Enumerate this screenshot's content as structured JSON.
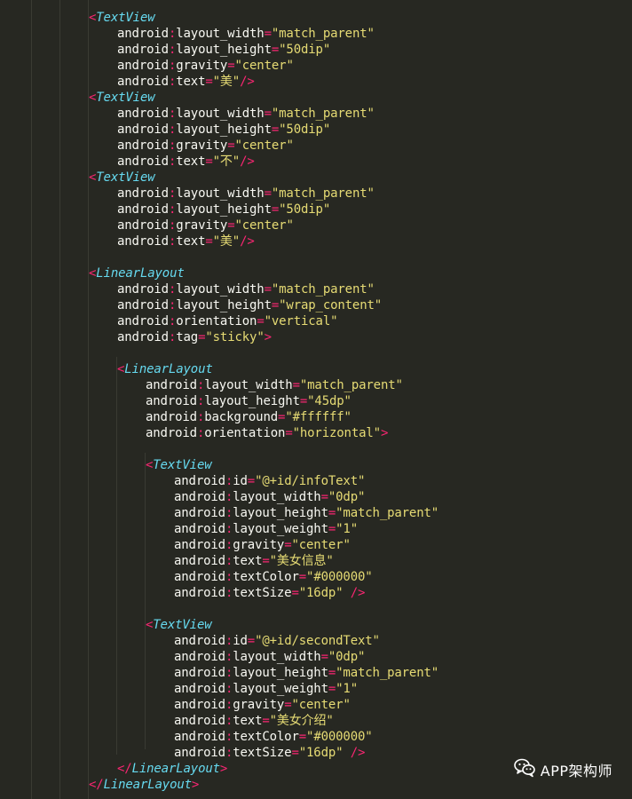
{
  "editor": {
    "theme_colors": {
      "background": "#272822",
      "tag": "#66d9ef",
      "punctuation": "#f92672",
      "attribute": "#f8f8f2",
      "string": "#e6db74"
    },
    "lines": [
      {
        "indent": 1,
        "type": "open",
        "tag": "TextView"
      },
      {
        "indent": 2,
        "type": "attr",
        "ns": "android",
        "name": "layout_width",
        "value": "match_parent"
      },
      {
        "indent": 2,
        "type": "attr",
        "ns": "android",
        "name": "layout_height",
        "value": "50dip"
      },
      {
        "indent": 2,
        "type": "attr",
        "ns": "android",
        "name": "gravity",
        "value": "center"
      },
      {
        "indent": 2,
        "type": "attr",
        "ns": "android",
        "name": "text",
        "value": "美",
        "suffix": "/>"
      },
      {
        "indent": 1,
        "type": "open",
        "tag": "TextView"
      },
      {
        "indent": 2,
        "type": "attr",
        "ns": "android",
        "name": "layout_width",
        "value": "match_parent"
      },
      {
        "indent": 2,
        "type": "attr",
        "ns": "android",
        "name": "layout_height",
        "value": "50dip"
      },
      {
        "indent": 2,
        "type": "attr",
        "ns": "android",
        "name": "gravity",
        "value": "center"
      },
      {
        "indent": 2,
        "type": "attr",
        "ns": "android",
        "name": "text",
        "value": "不",
        "suffix": "/>"
      },
      {
        "indent": 1,
        "type": "open",
        "tag": "TextView"
      },
      {
        "indent": 2,
        "type": "attr",
        "ns": "android",
        "name": "layout_width",
        "value": "match_parent"
      },
      {
        "indent": 2,
        "type": "attr",
        "ns": "android",
        "name": "layout_height",
        "value": "50dip"
      },
      {
        "indent": 2,
        "type": "attr",
        "ns": "android",
        "name": "gravity",
        "value": "center"
      },
      {
        "indent": 2,
        "type": "attr",
        "ns": "android",
        "name": "text",
        "value": "美",
        "suffix": "/>"
      },
      {
        "type": "blank"
      },
      {
        "indent": 1,
        "type": "open",
        "tag": "LinearLayout"
      },
      {
        "indent": 2,
        "type": "attr",
        "ns": "android",
        "name": "layout_width",
        "value": "match_parent"
      },
      {
        "indent": 2,
        "type": "attr",
        "ns": "android",
        "name": "layout_height",
        "value": "wrap_content"
      },
      {
        "indent": 2,
        "type": "attr",
        "ns": "android",
        "name": "orientation",
        "value": "vertical"
      },
      {
        "indent": 2,
        "type": "attr",
        "ns": "android",
        "name": "tag",
        "value": "sticky",
        "suffix": ">"
      },
      {
        "type": "blank"
      },
      {
        "indent": 2,
        "type": "open",
        "tag": "LinearLayout"
      },
      {
        "indent": 3,
        "type": "attr",
        "ns": "android",
        "name": "layout_width",
        "value": "match_parent"
      },
      {
        "indent": 3,
        "type": "attr",
        "ns": "android",
        "name": "layout_height",
        "value": "45dp"
      },
      {
        "indent": 3,
        "type": "attr",
        "ns": "android",
        "name": "background",
        "value": "#ffffff"
      },
      {
        "indent": 3,
        "type": "attr",
        "ns": "android",
        "name": "orientation",
        "value": "horizontal",
        "suffix": ">"
      },
      {
        "type": "blank"
      },
      {
        "indent": 3,
        "type": "open",
        "tag": "TextView"
      },
      {
        "indent": 4,
        "type": "attr",
        "ns": "android",
        "name": "id",
        "value": "@+id/infoText"
      },
      {
        "indent": 4,
        "type": "attr",
        "ns": "android",
        "name": "layout_width",
        "value": "0dp"
      },
      {
        "indent": 4,
        "type": "attr",
        "ns": "android",
        "name": "layout_height",
        "value": "match_parent"
      },
      {
        "indent": 4,
        "type": "attr",
        "ns": "android",
        "name": "layout_weight",
        "value": "1"
      },
      {
        "indent": 4,
        "type": "attr",
        "ns": "android",
        "name": "gravity",
        "value": "center"
      },
      {
        "indent": 4,
        "type": "attr",
        "ns": "android",
        "name": "text",
        "value": "美女信息"
      },
      {
        "indent": 4,
        "type": "attr",
        "ns": "android",
        "name": "textColor",
        "value": "#000000"
      },
      {
        "indent": 4,
        "type": "attr",
        "ns": "android",
        "name": "textSize",
        "value": "16dp",
        "suffix": " />"
      },
      {
        "type": "blank"
      },
      {
        "indent": 3,
        "type": "open",
        "tag": "TextView"
      },
      {
        "indent": 4,
        "type": "attr",
        "ns": "android",
        "name": "id",
        "value": "@+id/secondText"
      },
      {
        "indent": 4,
        "type": "attr",
        "ns": "android",
        "name": "layout_width",
        "value": "0dp"
      },
      {
        "indent": 4,
        "type": "attr",
        "ns": "android",
        "name": "layout_height",
        "value": "match_parent"
      },
      {
        "indent": 4,
        "type": "attr",
        "ns": "android",
        "name": "layout_weight",
        "value": "1"
      },
      {
        "indent": 4,
        "type": "attr",
        "ns": "android",
        "name": "gravity",
        "value": "center"
      },
      {
        "indent": 4,
        "type": "attr",
        "ns": "android",
        "name": "text",
        "value": "美女介绍"
      },
      {
        "indent": 4,
        "type": "attr",
        "ns": "android",
        "name": "textColor",
        "value": "#000000"
      },
      {
        "indent": 4,
        "type": "attr",
        "ns": "android",
        "name": "textSize",
        "value": "16dp",
        "suffix": " />"
      },
      {
        "indent": 2,
        "type": "close",
        "tag": "LinearLayout"
      },
      {
        "indent": 1,
        "type": "close",
        "tag": "LinearLayout"
      }
    ]
  },
  "watermark": {
    "icon": "wechat-icon",
    "text": "APP架构师"
  }
}
